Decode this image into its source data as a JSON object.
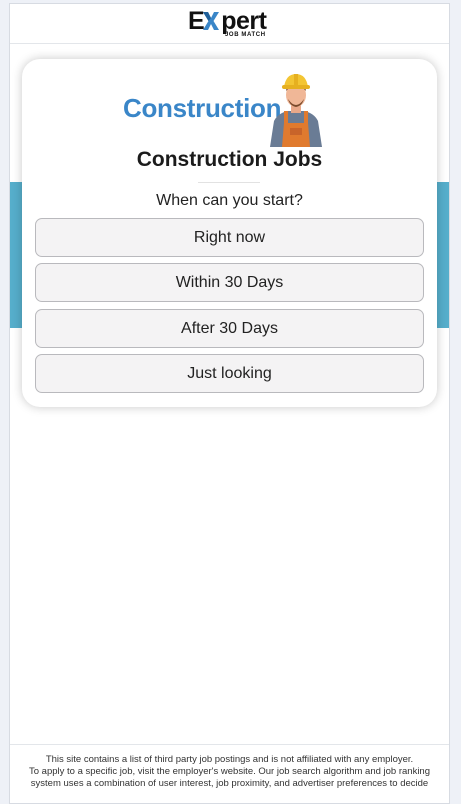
{
  "header": {
    "logo_word": "Expert",
    "logo_sub": "JOB MATCH"
  },
  "hero": {
    "image_word": "Construction",
    "title": "Construction Jobs",
    "question": "When can you start?"
  },
  "options": [
    {
      "label": "Right now"
    },
    {
      "label": "Within 30 Days"
    },
    {
      "label": "After 30 Days"
    },
    {
      "label": "Just looking"
    }
  ],
  "footer": {
    "line1": "This site contains a list of third party job postings and is not affiliated with any employer.",
    "line2": "To apply to a specific job, visit the employer's website. Our job search algorithm and job ranking",
    "line3": "system uses a combination of user interest, job proximity, and advertiser preferences to decide"
  },
  "colors": {
    "band": "#56aecb",
    "brand_blue": "#3a86c8",
    "logo_x_blue": "#3a86c8"
  }
}
